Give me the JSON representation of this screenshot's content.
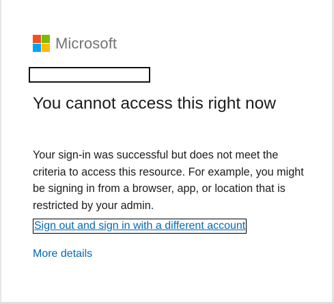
{
  "brand": {
    "name": "Microsoft",
    "logo_icon": "microsoft-four-squares-logo",
    "logo_colors": [
      "#f25022",
      "#7fba00",
      "#00a4ef",
      "#ffb900"
    ]
  },
  "identity": {
    "value": ""
  },
  "message": {
    "title": "You cannot access this right now",
    "description": "Your sign-in was successful but does not meet the criteria to access this resource. For example, you might be signing in from a browser, app, or location that is restricted by your admin."
  },
  "links": {
    "sign_out": "Sign out and sign in with a different account",
    "more_details": "More details"
  },
  "colors": {
    "link": "#0067b8",
    "text": "#1b1b1b",
    "logo_text": "#737373"
  }
}
